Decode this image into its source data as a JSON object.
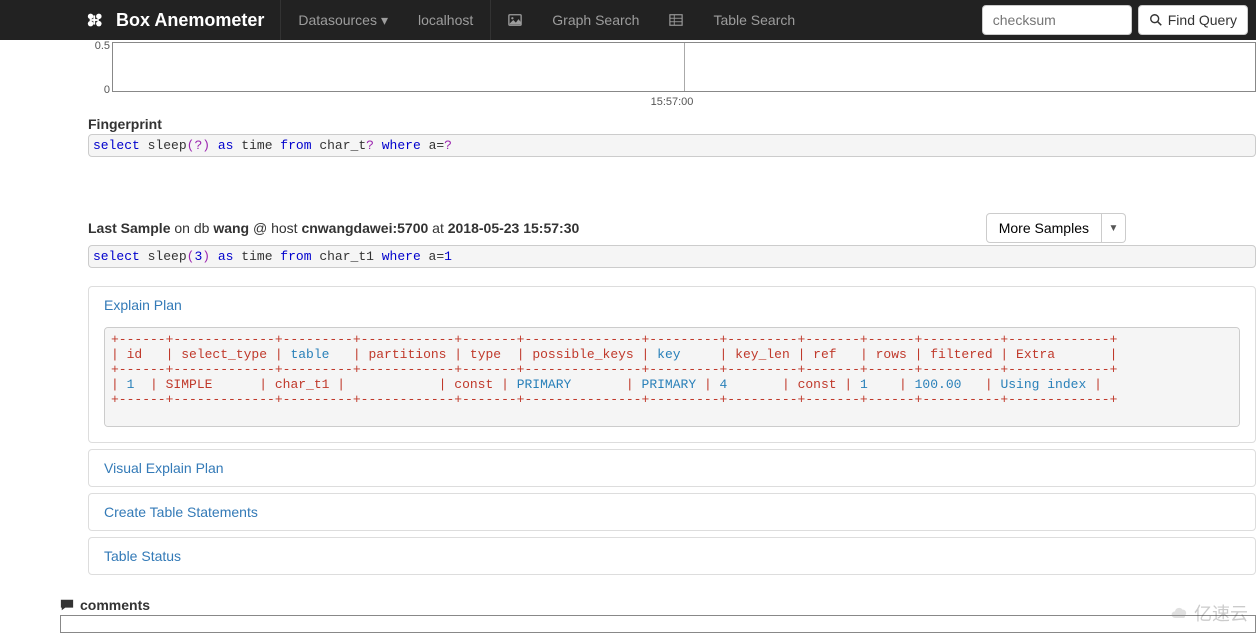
{
  "nav": {
    "brand": "Box Anemometer",
    "datasources": "Datasources",
    "localhost": "localhost",
    "graph_search": "Graph Search",
    "table_search": "Table Search",
    "search_placeholder": "checksum",
    "find_label": "Find Query"
  },
  "chart_data": {
    "type": "line",
    "ylim": [
      0.0,
      0.5
    ],
    "yticks": [
      0.5,
      0.0
    ],
    "xticks": [
      "15:57:00"
    ],
    "series": []
  },
  "fingerprint": {
    "label": "Fingerprint",
    "sql_tokens": [
      {
        "t": "select",
        "c": "kw"
      },
      {
        "t": " sleep",
        "c": ""
      },
      {
        "t": "(",
        "c": "paren"
      },
      {
        "t": "?",
        "c": "paren"
      },
      {
        "t": ")",
        "c": "paren"
      },
      {
        "t": " ",
        "c": ""
      },
      {
        "t": "as",
        "c": "kw"
      },
      {
        "t": " time ",
        "c": ""
      },
      {
        "t": "from",
        "c": "kw"
      },
      {
        "t": " char_t",
        "c": ""
      },
      {
        "t": "?",
        "c": "paren"
      },
      {
        "t": " ",
        "c": ""
      },
      {
        "t": "where",
        "c": "kw"
      },
      {
        "t": " a=",
        "c": ""
      },
      {
        "t": "?",
        "c": "paren"
      }
    ]
  },
  "last_sample": {
    "prefix": "Last Sample",
    "on_db": " on db ",
    "db": "wang",
    "at_host": " @ host ",
    "host": "cnwangdawei:5700",
    "at": " at ",
    "ts": "2018-05-23 15:57:30",
    "more_label": "More Samples",
    "sql_tokens": [
      {
        "t": "select",
        "c": "kw"
      },
      {
        "t": " sleep",
        "c": ""
      },
      {
        "t": "(",
        "c": "paren"
      },
      {
        "t": "3",
        "c": "num"
      },
      {
        "t": ")",
        "c": "paren"
      },
      {
        "t": " ",
        "c": ""
      },
      {
        "t": "as",
        "c": "kw"
      },
      {
        "t": " time ",
        "c": ""
      },
      {
        "t": "from",
        "c": "kw"
      },
      {
        "t": " char_t1 ",
        "c": ""
      },
      {
        "t": "where",
        "c": "kw"
      },
      {
        "t": " a=",
        "c": ""
      },
      {
        "t": "1",
        "c": "num"
      }
    ]
  },
  "panels": {
    "explain": "Explain Plan",
    "visual": "Visual Explain Plan",
    "create": "Create Table Statements",
    "status": "Table Status"
  },
  "explain_plan": {
    "border": "+------+-------------+---------+------------+-------+---------------+---------+---------+-------+------+----------+-------------+",
    "header_tokens": [
      {
        "t": "| id   | select_type | ",
        "c": "red"
      },
      {
        "t": "table",
        "c": "blue"
      },
      {
        "t": "   | partitions | ",
        "c": "red"
      },
      {
        "t": "type",
        "c": "red"
      },
      {
        "t": "  | possible_keys | ",
        "c": "red"
      },
      {
        "t": "key",
        "c": "blue"
      },
      {
        "t": "     | key_len | ",
        "c": "red"
      },
      {
        "t": "ref",
        "c": "red"
      },
      {
        "t": "   | ",
        "c": "red"
      },
      {
        "t": "rows",
        "c": "red"
      },
      {
        "t": " | filtered | ",
        "c": "red"
      },
      {
        "t": "Extra",
        "c": "red"
      },
      {
        "t": "       |",
        "c": "red"
      }
    ],
    "row_tokens": [
      {
        "t": "| ",
        "c": "red"
      },
      {
        "t": "1",
        "c": "blue"
      },
      {
        "t": "  | SIMPLE      | char_t1 |            | ",
        "c": "red"
      },
      {
        "t": "const",
        "c": "red"
      },
      {
        "t": " | ",
        "c": "red"
      },
      {
        "t": "PRIMARY",
        "c": "blue"
      },
      {
        "t": "       | ",
        "c": "red"
      },
      {
        "t": "PRIMARY",
        "c": "blue"
      },
      {
        "t": " | ",
        "c": "red"
      },
      {
        "t": "4",
        "c": "blue"
      },
      {
        "t": "       | ",
        "c": "red"
      },
      {
        "t": "const",
        "c": "red"
      },
      {
        "t": " | ",
        "c": "red"
      },
      {
        "t": "1",
        "c": "blue"
      },
      {
        "t": "    | ",
        "c": "red"
      },
      {
        "t": "100.00",
        "c": "blue"
      },
      {
        "t": "   | ",
        "c": "red"
      },
      {
        "t": "Using index",
        "c": "blue"
      },
      {
        "t": " |",
        "c": "red"
      }
    ]
  },
  "comments": {
    "label": "comments"
  },
  "watermark": "亿速云"
}
